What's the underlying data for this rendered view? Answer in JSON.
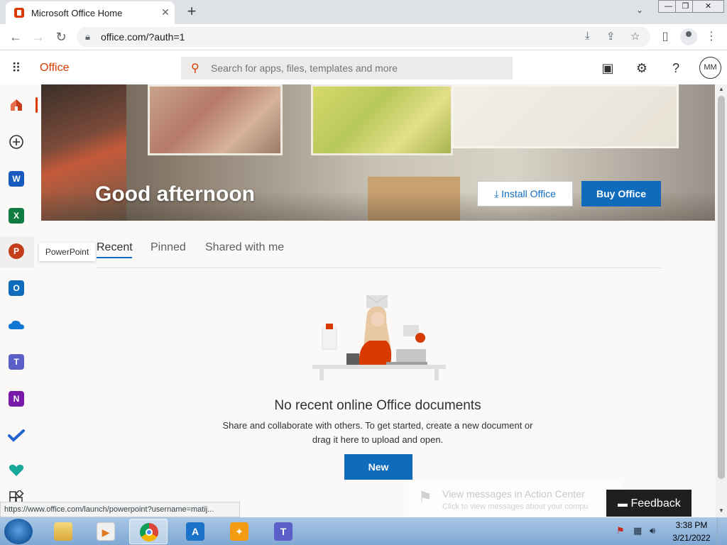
{
  "browser": {
    "tab_title": "Microsoft Office Home",
    "url": "office.com/?auth=1",
    "status_url": "https://www.office.com/launch/powerpoint?username=matij..."
  },
  "header": {
    "brand": "Office",
    "search_placeholder": "Search for apps, files, templates and more",
    "avatar_initials": "MM"
  },
  "rail": {
    "items": [
      {
        "name": "home",
        "icon": "home-icon"
      },
      {
        "name": "create",
        "icon": "plus-circle-icon"
      },
      {
        "name": "word",
        "icon": "word-icon",
        "letter": "W",
        "color": "#185abd"
      },
      {
        "name": "excel",
        "icon": "excel-icon",
        "letter": "X",
        "color": "#107c41"
      },
      {
        "name": "powerpoint",
        "icon": "powerpoint-icon",
        "letter": "P",
        "color": "#c43e1c"
      },
      {
        "name": "outlook",
        "icon": "outlook-icon",
        "letter": "O",
        "color": "#0f6cbd"
      },
      {
        "name": "onedrive",
        "icon": "onedrive-icon"
      },
      {
        "name": "teams",
        "icon": "teams-icon",
        "letter": "T",
        "color": "#5b5fc7"
      },
      {
        "name": "onenote",
        "icon": "onenote-icon",
        "letter": "N",
        "color": "#7719aa"
      },
      {
        "name": "todo",
        "icon": "todo-icon"
      },
      {
        "name": "sway",
        "icon": "heart-icon"
      },
      {
        "name": "all-apps",
        "icon": "apps-icon"
      }
    ],
    "tooltip": "PowerPoint"
  },
  "hero": {
    "greeting": "Good afternoon",
    "install_label": "Install Office",
    "buy_label": "Buy Office"
  },
  "files": {
    "tabs": [
      "Recent",
      "Pinned",
      "Shared with me"
    ],
    "active_tab": "Recent",
    "empty_title": "No recent online Office documents",
    "empty_desc": "Share and collaborate with others. To get started, create a new document or drag it here to upload and open.",
    "new_label": "New"
  },
  "notification": {
    "title": "View messages in Action Center",
    "subtitle": "Click to view messages about your compu"
  },
  "feedback_label": "Feedback",
  "taskbar": {
    "time": "3:38 PM",
    "date": "3/21/2022"
  },
  "colors": {
    "accent": "#0f6cbd",
    "brand": "#d83b01"
  }
}
